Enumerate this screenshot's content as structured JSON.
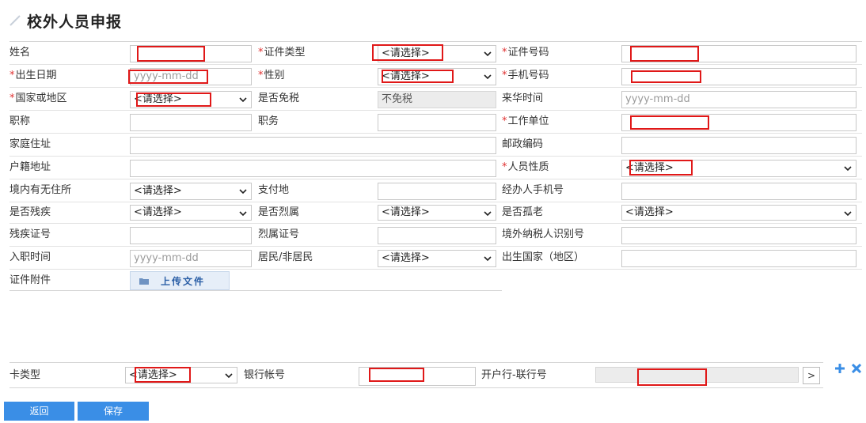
{
  "page": {
    "title": "校外人员申报"
  },
  "form": {
    "name_label": "姓名",
    "id_type_label": "证件类型",
    "id_type_value": "<请选择>",
    "id_number_label": "证件号码",
    "birth_label": "出生日期",
    "birth_placeholder": "yyyy-mm-dd",
    "gender_label": "性别",
    "gender_value": "<请选择>",
    "mobile_label": "手机号码",
    "country_label": "国家或地区",
    "country_value": "<请选择>",
    "tax_exempt_label": "是否免税",
    "tax_exempt_value": "不免税",
    "arrival_label": "来华时间",
    "arrival_placeholder": "yyyy-mm-dd",
    "title_label": "职称",
    "position_label": "职务",
    "employer_label": "工作单位",
    "home_address_label": "家庭住址",
    "postal_label": "邮政编码",
    "hukou_label": "户籍地址",
    "person_type_label": "人员性质",
    "person_type_value": "<请选择>",
    "no_residence_label": "境内有无住所",
    "no_residence_value": "<请选择>",
    "pay_place_label": "支付地",
    "handler_mobile_label": "经办人手机号",
    "disabled_label": "是否残疾",
    "disabled_value": "<请选择>",
    "martyr_label": "是否烈属",
    "martyr_value": "<请选择>",
    "elderly_label": "是否孤老",
    "elderly_value": "<请选择>",
    "disability_cert_label": "残疾证号",
    "martyr_cert_label": "烈属证号",
    "foreign_tax_id_label": "境外纳税人识别号",
    "hire_date_label": "入职时间",
    "hire_date_placeholder": "yyyy-mm-dd",
    "resident_label": "居民/非居民",
    "resident_value": "<请选择>",
    "birth_country_label": "出生国家（地区）",
    "attachment_label": "证件附件",
    "upload_label": "上传文件"
  },
  "bank": {
    "card_type_label": "卡类型",
    "card_type_value": "<请选择>",
    "account_label": "银行帐号",
    "branch_label": "开户行-联行号",
    "nav_glyph": ">"
  },
  "buttons": {
    "back": "返回",
    "save": "保存"
  },
  "colors": {
    "accent": "#3a8ee6",
    "required": "#e03030",
    "highlight": "#e01818"
  }
}
